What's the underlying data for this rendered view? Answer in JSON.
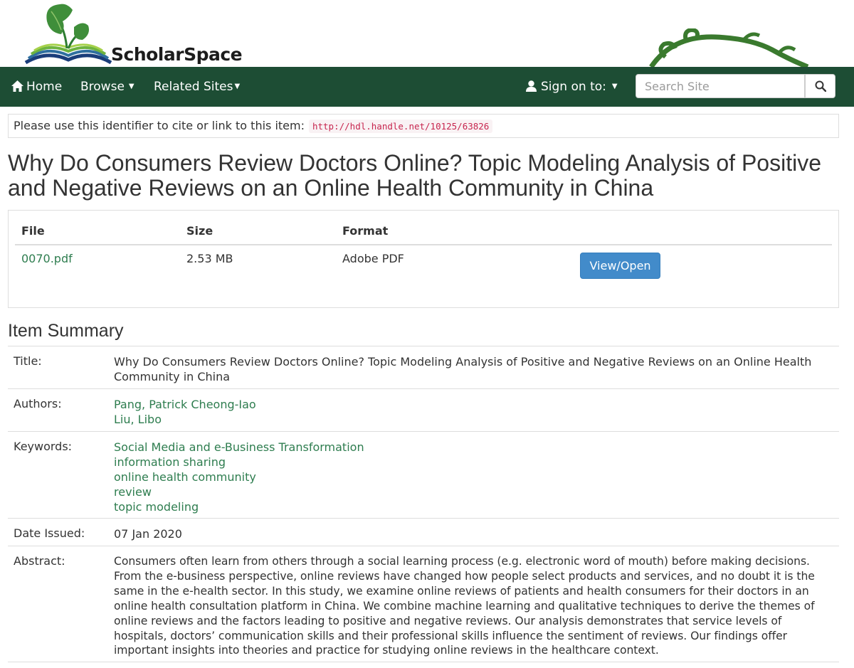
{
  "header": {
    "logo_text": "ScholarSpace"
  },
  "nav": {
    "home": "Home",
    "browse": "Browse",
    "related": "Related Sites",
    "signon": "Sign on to:",
    "search_placeholder": "Search Site"
  },
  "identifier": {
    "label": "Please use this identifier to cite or link to this item:",
    "url": "http://hdl.handle.net/10125/63826"
  },
  "title": "Why Do Consumers Review Doctors Online? Topic Modeling Analysis of Positive and Negative Reviews on an Online Health Community in China",
  "files": {
    "headers": {
      "file": "File",
      "size": "Size",
      "format": "Format"
    },
    "rows": [
      {
        "name": "0070.pdf",
        "size": "2.53 MB",
        "format": "Adobe PDF",
        "action": "View/Open"
      }
    ]
  },
  "summary": {
    "heading": "Item Summary",
    "title_label": "Title:",
    "title_value": "Why Do Consumers Review Doctors Online? Topic Modeling Analysis of Positive and Negative Reviews on an Online Health Community in China",
    "authors_label": "Authors:",
    "authors": [
      "Pang, Patrick Cheong-Iao",
      "Liu, Libo"
    ],
    "keywords_label": "Keywords:",
    "keywords": [
      "Social Media and e-Business Transformation",
      "information sharing",
      "online health community",
      "review",
      "topic modeling"
    ],
    "date_label": "Date Issued:",
    "date_value": "07 Jan 2020",
    "abstract_label": "Abstract:",
    "abstract_value": "Consumers often learn from others through a social learning process (e.g. electronic word of mouth) before making decisions. From the e-business perspective, online reviews have changed how people select products and services, and no doubt it is the same in the e-health sector. In this study, we examine online reviews of patients and health consumers for their doctors in an online health consultation platform in China. We combine machine learning and qualitative techniques to derive the themes of online reviews and the factors leading to positive and negative reviews. Our analysis demonstrates that service levels of hospitals, doctors’ communication skills and their professional skills influence the sentiment of reviews. Our findings offer important insights into theories and practice for studying online reviews in the healthcare context."
  },
  "colors": {
    "navbar": "#1d4d34",
    "link": "#2e7d4f",
    "button": "#428bca"
  }
}
